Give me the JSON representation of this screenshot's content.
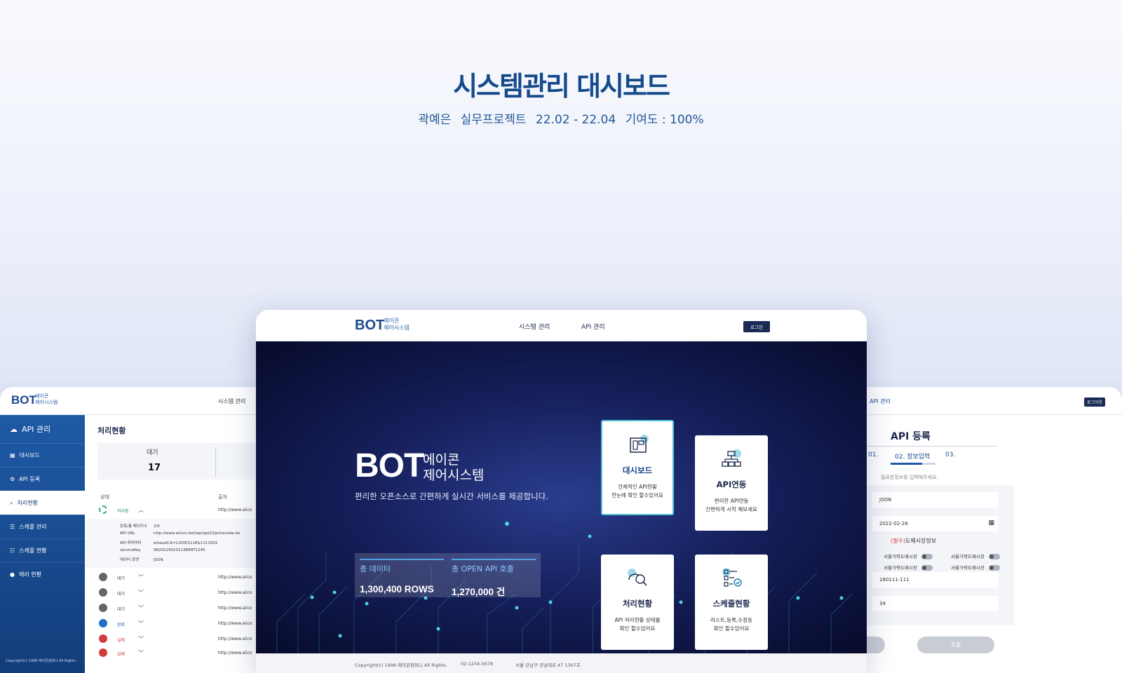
{
  "hero": {
    "title": "시스템관리 대시보드",
    "author": "곽예은",
    "project": "실무프로젝트",
    "period": "22.02 - 22.04",
    "contribution": "기여도 : 100%"
  },
  "colors": {
    "accent": "#1a4a8e",
    "dark_bg": "#0b1140",
    "teal": "#58c4d4"
  },
  "left_screen": {
    "logo": "BOT",
    "logo_sub_1": "에이콘",
    "logo_sub_2": "제어시스템",
    "nav": "시스템 관리",
    "sidebar_title": "API 관리",
    "sidebar_items": [
      {
        "label": "대시보드",
        "icon": "dashboard-icon"
      },
      {
        "label": "API 등록",
        "icon": "api-register-icon"
      },
      {
        "label": "처리현황",
        "icon": "processing-icon"
      },
      {
        "label": "스케줄 관리",
        "icon": "schedule-list-icon"
      },
      {
        "label": "스케줄 현황",
        "icon": "schedule-status-icon"
      },
      {
        "label": "에러 현황",
        "icon": "error-icon"
      }
    ],
    "copyright": "Copyright(c) 1996 에이콘컴퍼니 All Rights.",
    "page_title": "처리현황",
    "stat_label": "대기",
    "stat_value": "17",
    "col_status": "상태",
    "col_source": "출처",
    "rows": [
      {
        "status": "처리중",
        "url": "http://www.aiico"
      },
      {
        "status": "대기",
        "url": "http://www.aiico"
      },
      {
        "status": "대기",
        "url": "http://www.aiico"
      },
      {
        "status": "대기",
        "url": "http://www.aiico"
      },
      {
        "status": "완료",
        "url": "http://www.aiico"
      },
      {
        "status": "실패",
        "url": "http://www.aiico"
      },
      {
        "status": "실패",
        "url": "http://www.aiico"
      }
    ],
    "detail": [
      {
        "k": "완료/총 페이지수",
        "v": "2/5"
      },
      {
        "k": "API URL",
        "v": "http://www.aiicon.bot/api/api22/price/sale.do"
      },
      {
        "k": "API 파라미터",
        "v": "whasalCd=110001118&1111002"
      },
      {
        "k": "serviceKey",
        "v": "9820124S1S113ERRT1245"
      },
      {
        "k": "데이터 포맷",
        "v": "JSON"
      }
    ]
  },
  "right_screen": {
    "nav": "API 관리",
    "login": "로그아웃",
    "title": "API 등록",
    "steps": [
      "01.",
      "02. 정보입력",
      "03."
    ],
    "progress": 0.7,
    "hint": "필요한정보를 입력해주세요.",
    "field_format": "JSON",
    "field_date": "2022-02-28",
    "required_mark": "(필수)",
    "required_label": "도매시장정보",
    "toggle_label": "서울가락도매시장",
    "field_code": "180111-111",
    "field_num": "34",
    "button_call": "호출"
  },
  "center_screen": {
    "logo": "BOT",
    "logo_sub_1": "에이콘",
    "logo_sub_2": "제어시스템",
    "nav_1": "시스템 관리",
    "nav_2": "API 관리",
    "login": "로그인",
    "brand": "BOT",
    "brand_sub_1": "에이콘",
    "brand_sub_2": "제어시스템",
    "tagline": "편리한 오픈소스로 간편하게 실시간 서비스를 제공합니다.",
    "stat_1_label": "총 데이터",
    "stat_1_value": "1,300,400 ROWS",
    "stat_2_label": "총 OPEN API 호출",
    "stat_2_value": "1,270,000 건",
    "cards": [
      {
        "title": "대시보드",
        "desc_1": "전체적인 API현황",
        "desc_2": "한눈에 확인 할수있어요",
        "icon": "dashboard-icon"
      },
      {
        "title": "API연동",
        "desc_1": "편리한 API연동",
        "desc_2": "간편하게 시작 해보세요",
        "icon": "api-link-icon"
      },
      {
        "title": "처리현황",
        "desc_1": "API 처리현황 상태를",
        "desc_2": "확인 할수있어요",
        "icon": "processing-icon"
      },
      {
        "title": "스케줄현황",
        "desc_1": "리스트,등록,수정등",
        "desc_2": "확인 할수있어요",
        "icon": "schedule-icon"
      }
    ],
    "footer_copy": "Copyright(c) 1996 에이콘컴퍼니 All Rights.",
    "footer_tel": "02-1234-5678",
    "footer_addr": "서울 강남구 강남대로 47 1307호"
  }
}
